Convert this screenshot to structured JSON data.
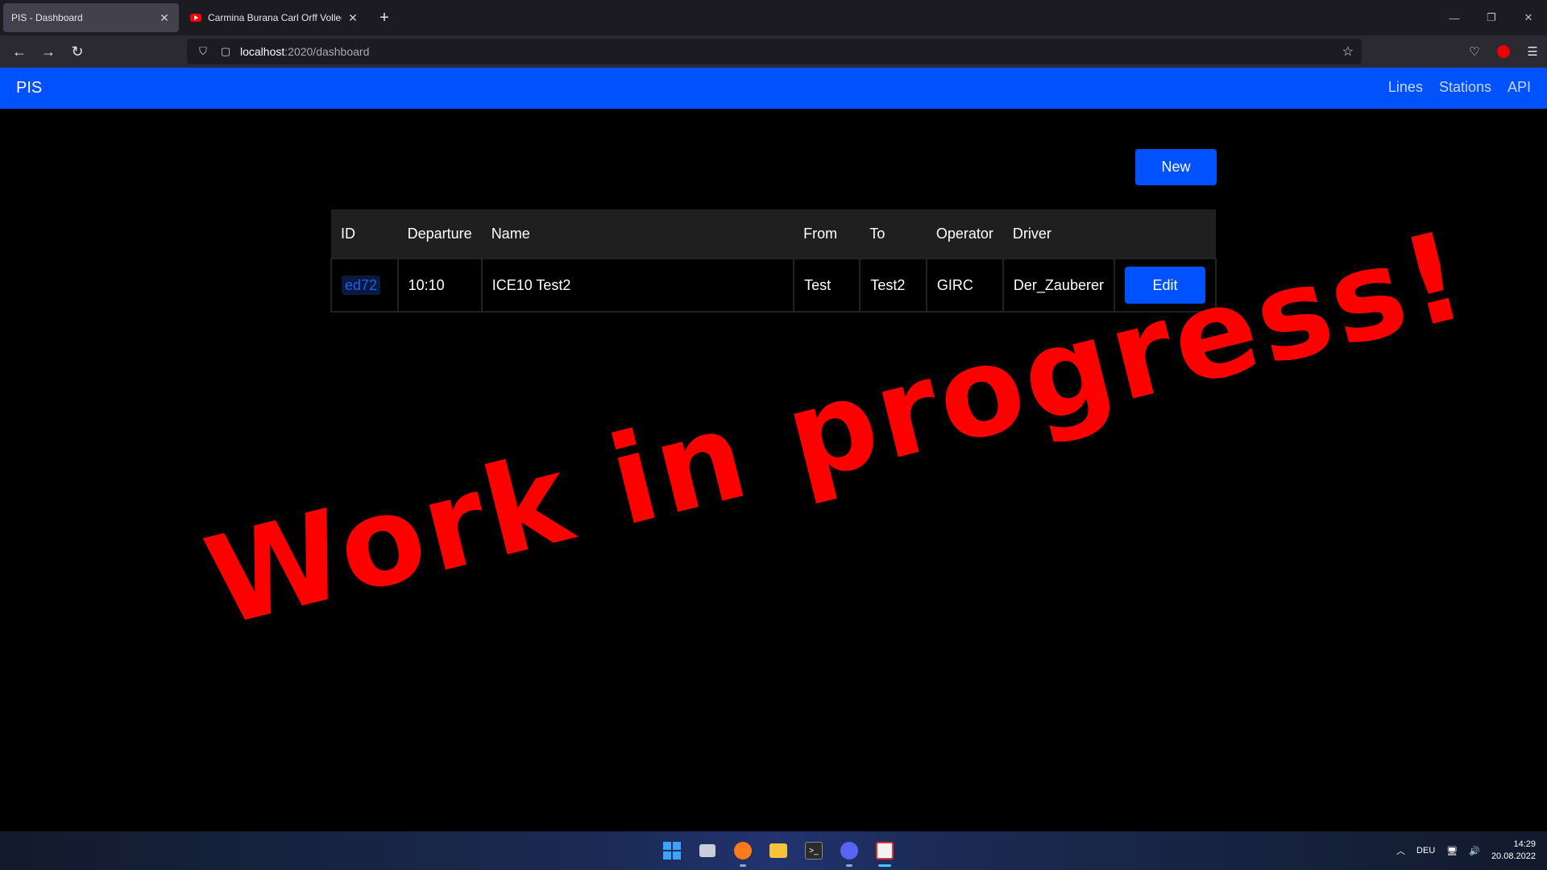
{
  "browser": {
    "tabs": [
      {
        "title": "PIS - Dashboard",
        "active": true
      },
      {
        "title": "Carmina Burana Carl Orff Vollec",
        "active": false
      }
    ],
    "url_host": "localhost",
    "url_path": ":2020/dashboard"
  },
  "app": {
    "brand": "PIS",
    "nav": [
      "Lines",
      "Stations",
      "API"
    ],
    "new_button": "New",
    "table": {
      "headers": [
        "ID",
        "Departure",
        "Name",
        "From",
        "To",
        "Operator",
        "Driver"
      ],
      "rows": [
        {
          "id": "ed72",
          "departure": "10:10",
          "name": "ICE10 Test2",
          "from": "Test",
          "to": "Test2",
          "operator": "GIRC",
          "driver": "Der_Zauberer",
          "action": "Edit"
        }
      ]
    },
    "overlay": "Work in progress!"
  },
  "taskbar": {
    "language": "DEU",
    "time": "14:29",
    "date": "20.08.2022"
  },
  "colors": {
    "accent": "#0051ff",
    "overlay": "#ff0000"
  }
}
